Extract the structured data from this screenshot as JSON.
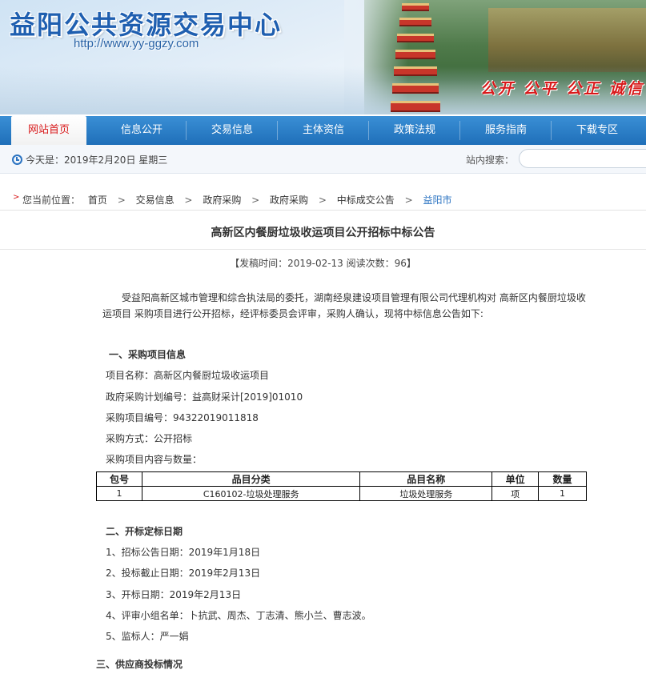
{
  "header": {
    "site_title": "益阳公共资源交易中心",
    "site_url": "http://www.yy-ggzy.com",
    "slogan": "公开 公平 公正 诚信"
  },
  "nav": {
    "items": [
      "网站首页",
      "信息公开",
      "交易信息",
      "主体资信",
      "政策法规",
      "服务指南",
      "下载专区"
    ],
    "active_index": 0
  },
  "infobar": {
    "today": "今天是：2019年2月20日 星期三",
    "search_label": "站内搜索：",
    "search_value": ""
  },
  "breadcrumb": {
    "prefix": "您当前位置：",
    "items": [
      "首页",
      "交易信息",
      "政府采购",
      "政府采购",
      "中标成交公告",
      "益阳市"
    ]
  },
  "article": {
    "title": "高新区内餐厨垃圾收运项目公开招标中标公告",
    "meta": "【发稿时间：2019-02-13   阅读次数：96】",
    "intro": "受益阳高新区城市管理和综合执法局的委托，湖南经泉建设项目管理有限公司代理机构对 高新区内餐厨垃圾收运项目 采购项目进行公开招标，经评标委员会评审，采购人确认，现将中标信息公告如下:",
    "section1_title": "一、采购项目信息",
    "project_name": "项目名称：高新区内餐厨垃圾收运项目",
    "plan_no": "政府采购计划编号：益高财采计[2019]01010",
    "project_no": "采购项目编号：94322019011818",
    "method": "采购方式：公开招标",
    "content_label": "采购项目内容与数量：",
    "table": {
      "headers": [
        "包号",
        "品目分类",
        "品目名称",
        "单位",
        "数量"
      ],
      "rows": [
        [
          "1",
          "C160102-垃圾处理服务",
          "垃圾处理服务",
          "项",
          "1"
        ]
      ]
    },
    "section2_title": "二、开标定标日期",
    "dates": [
      "1、招标公告日期：2019年1月18日",
      "2、投标截止日期：2019年2月13日",
      "3、开标日期：2019年2月13日",
      "4、评审小组名单：卜抗武、周杰、丁志清、熊小兰、曹志波。",
      "5、监标人：严一娟"
    ],
    "section3_title": "三、供应商投标情况"
  },
  "colors": {
    "nav_blue": "#2a7cc5",
    "title_blue": "#1f5fb0",
    "slogan_red": "#d8191a",
    "link_blue": "#2c74c2"
  }
}
